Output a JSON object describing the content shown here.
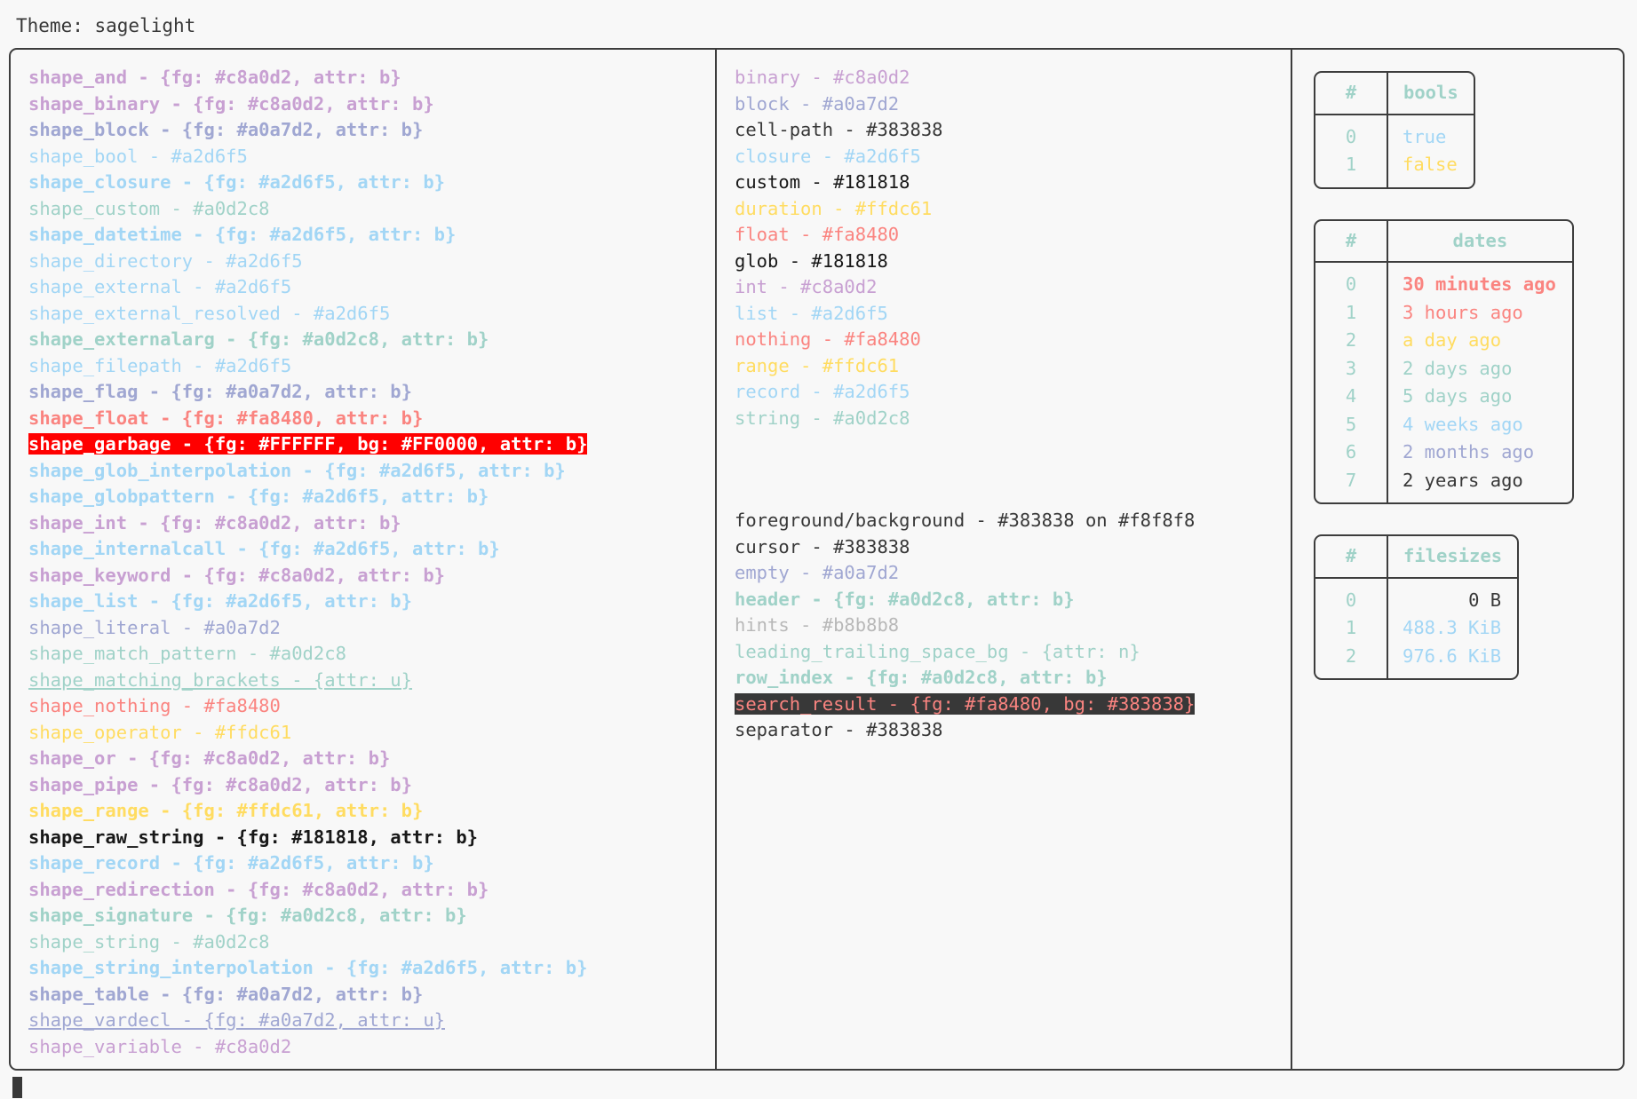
{
  "header": {
    "label": "Theme: sagelight"
  },
  "palette": {
    "fg": "#383838",
    "bg": "#f8f8f8",
    "purple": "#c8a0d2",
    "lavender": "#a0a7d2",
    "blue": "#a2d6f5",
    "green": "#a0d2c8",
    "red": "#fa8480",
    "yellow": "#ffdc61",
    "black": "#181818",
    "grey": "#b8b8b8",
    "dark": "#383838",
    "garbage_bg": "#FF0000",
    "garbage_fg": "#FFFFFF"
  },
  "shapes": [
    {
      "text": "shape_and - {fg: #c8a0d2, attr: b}",
      "color": "#c8a0d2",
      "bold": true,
      "underline": false
    },
    {
      "text": "shape_binary - {fg: #c8a0d2, attr: b}",
      "color": "#c8a0d2",
      "bold": true,
      "underline": false
    },
    {
      "text": "shape_block - {fg: #a0a7d2, attr: b}",
      "color": "#a0a7d2",
      "bold": true,
      "underline": false
    },
    {
      "text": "shape_bool - #a2d6f5",
      "color": "#a2d6f5",
      "bold": false,
      "underline": false
    },
    {
      "text": "shape_closure - {fg: #a2d6f5, attr: b}",
      "color": "#a2d6f5",
      "bold": true,
      "underline": false
    },
    {
      "text": "shape_custom - #a0d2c8",
      "color": "#a0d2c8",
      "bold": false,
      "underline": false
    },
    {
      "text": "shape_datetime - {fg: #a2d6f5, attr: b}",
      "color": "#a2d6f5",
      "bold": true,
      "underline": false
    },
    {
      "text": "shape_directory - #a2d6f5",
      "color": "#a2d6f5",
      "bold": false,
      "underline": false
    },
    {
      "text": "shape_external - #a2d6f5",
      "color": "#a2d6f5",
      "bold": false,
      "underline": false
    },
    {
      "text": "shape_external_resolved - #a2d6f5",
      "color": "#a2d6f5",
      "bold": false,
      "underline": false
    },
    {
      "text": "shape_externalarg - {fg: #a0d2c8, attr: b}",
      "color": "#a0d2c8",
      "bold": true,
      "underline": false
    },
    {
      "text": "shape_filepath - #a2d6f5",
      "color": "#a2d6f5",
      "bold": false,
      "underline": false
    },
    {
      "text": "shape_flag - {fg: #a0a7d2, attr: b}",
      "color": "#a0a7d2",
      "bold": true,
      "underline": false
    },
    {
      "text": "shape_float - {fg: #fa8480, attr: b}",
      "color": "#fa8480",
      "bold": true,
      "underline": false
    },
    {
      "text": "shape_garbage - {fg: #FFFFFF, bg: #FF0000, attr: b}",
      "color": "#FFFFFF",
      "bg": "#FF0000",
      "bold": true,
      "underline": false
    },
    {
      "text": "shape_glob_interpolation - {fg: #a2d6f5, attr: b}",
      "color": "#a2d6f5",
      "bold": true,
      "underline": false
    },
    {
      "text": "shape_globpattern - {fg: #a2d6f5, attr: b}",
      "color": "#a2d6f5",
      "bold": true,
      "underline": false
    },
    {
      "text": "shape_int - {fg: #c8a0d2, attr: b}",
      "color": "#c8a0d2",
      "bold": true,
      "underline": false
    },
    {
      "text": "shape_internalcall - {fg: #a2d6f5, attr: b}",
      "color": "#a2d6f5",
      "bold": true,
      "underline": false
    },
    {
      "text": "shape_keyword - {fg: #c8a0d2, attr: b}",
      "color": "#c8a0d2",
      "bold": true,
      "underline": false
    },
    {
      "text": "shape_list - {fg: #a2d6f5, attr: b}",
      "color": "#a2d6f5",
      "bold": true,
      "underline": false
    },
    {
      "text": "shape_literal - #a0a7d2",
      "color": "#a0a7d2",
      "bold": false,
      "underline": false
    },
    {
      "text": "shape_match_pattern - #a0d2c8",
      "color": "#a0d2c8",
      "bold": false,
      "underline": false
    },
    {
      "text": "shape_matching_brackets - {attr: u}",
      "color": "#a0d2c8",
      "bold": false,
      "underline": true
    },
    {
      "text": "shape_nothing - #fa8480",
      "color": "#fa8480",
      "bold": false,
      "underline": false
    },
    {
      "text": "shape_operator - #ffdc61",
      "color": "#ffdc61",
      "bold": false,
      "underline": false
    },
    {
      "text": "shape_or - {fg: #c8a0d2, attr: b}",
      "color": "#c8a0d2",
      "bold": true,
      "underline": false
    },
    {
      "text": "shape_pipe - {fg: #c8a0d2, attr: b}",
      "color": "#c8a0d2",
      "bold": true,
      "underline": false
    },
    {
      "text": "shape_range - {fg: #ffdc61, attr: b}",
      "color": "#ffdc61",
      "bold": true,
      "underline": false
    },
    {
      "text": "shape_raw_string - {fg: #181818, attr: b}",
      "color": "#181818",
      "bold": true,
      "underline": false
    },
    {
      "text": "shape_record - {fg: #a2d6f5, attr: b}",
      "color": "#a2d6f5",
      "bold": true,
      "underline": false
    },
    {
      "text": "shape_redirection - {fg: #c8a0d2, attr: b}",
      "color": "#c8a0d2",
      "bold": true,
      "underline": false
    },
    {
      "text": "shape_signature - {fg: #a0d2c8, attr: b}",
      "color": "#a0d2c8",
      "bold": true,
      "underline": false
    },
    {
      "text": "shape_string - #a0d2c8",
      "color": "#a0d2c8",
      "bold": false,
      "underline": false
    },
    {
      "text": "shape_string_interpolation - {fg: #a2d6f5, attr: b}",
      "color": "#a2d6f5",
      "bold": true,
      "underline": false
    },
    {
      "text": "shape_table - {fg: #a0a7d2, attr: b}",
      "color": "#a0a7d2",
      "bold": true,
      "underline": false
    },
    {
      "text": "shape_vardecl - {fg: #a0a7d2, attr: u}",
      "color": "#a0a7d2",
      "bold": false,
      "underline": true
    },
    {
      "text": "shape_variable - #c8a0d2",
      "color": "#c8a0d2",
      "bold": false,
      "underline": false
    }
  ],
  "types": [
    {
      "text": "binary - #c8a0d2",
      "color": "#c8a0d2",
      "bold": false,
      "underline": false
    },
    {
      "text": "block - #a0a7d2",
      "color": "#a0a7d2",
      "bold": false,
      "underline": false
    },
    {
      "text": "cell-path - #383838",
      "color": "#383838",
      "bold": false,
      "underline": false
    },
    {
      "text": "closure - #a2d6f5",
      "color": "#a2d6f5",
      "bold": false,
      "underline": false
    },
    {
      "text": "custom - #181818",
      "color": "#181818",
      "bold": false,
      "underline": false
    },
    {
      "text": "duration - #ffdc61",
      "color": "#ffdc61",
      "bold": false,
      "underline": false
    },
    {
      "text": "float - #fa8480",
      "color": "#fa8480",
      "bold": false,
      "underline": false
    },
    {
      "text": "glob - #181818",
      "color": "#181818",
      "bold": false,
      "underline": false
    },
    {
      "text": "int - #c8a0d2",
      "color": "#c8a0d2",
      "bold": false,
      "underline": false
    },
    {
      "text": "list - #a2d6f5",
      "color": "#a2d6f5",
      "bold": false,
      "underline": false
    },
    {
      "text": "nothing - #fa8480",
      "color": "#fa8480",
      "bold": false,
      "underline": false
    },
    {
      "text": "range - #ffdc61",
      "color": "#ffdc61",
      "bold": false,
      "underline": false
    },
    {
      "text": "record - #a2d6f5",
      "color": "#a2d6f5",
      "bold": false,
      "underline": false
    },
    {
      "text": "string - #a0d2c8",
      "color": "#a0d2c8",
      "bold": false,
      "underline": false
    }
  ],
  "ui_elements": [
    {
      "text": "foreground/background - #383838 on #f8f8f8",
      "color": "#383838",
      "bold": false,
      "underline": false
    },
    {
      "text": "cursor - #383838",
      "color": "#383838",
      "bold": false,
      "underline": false
    },
    {
      "text": "empty - #a0a7d2",
      "color": "#a0a7d2",
      "bold": false,
      "underline": false
    },
    {
      "text": "header - {fg: #a0d2c8, attr: b}",
      "color": "#a0d2c8",
      "bold": true,
      "underline": false
    },
    {
      "text": "hints - #b8b8b8",
      "color": "#b8b8b8",
      "bold": false,
      "underline": false
    },
    {
      "text": "leading_trailing_space_bg - {attr: n}",
      "color": "#a0d2c8",
      "bold": false,
      "underline": false
    },
    {
      "text": "row_index - {fg: #a0d2c8, attr: b}",
      "color": "#a0d2c8",
      "bold": true,
      "underline": false
    },
    {
      "text": "search_result - {fg: #fa8480, bg: #383838}",
      "color": "#fa8480",
      "bg": "#383838",
      "bold": false,
      "underline": false
    },
    {
      "text": "separator - #383838",
      "color": "#383838",
      "bold": false,
      "underline": false
    }
  ],
  "tables": [
    {
      "name": "bools",
      "index_header": "#",
      "value_header": "bools",
      "align": "left",
      "rows": [
        {
          "index": "0",
          "value": "true",
          "color": "#a2d6f5",
          "bold": false
        },
        {
          "index": "1",
          "value": "false",
          "color": "#ffdc61",
          "bold": false
        }
      ]
    },
    {
      "name": "dates",
      "index_header": "#",
      "value_header": "dates",
      "align": "left",
      "rows": [
        {
          "index": "0",
          "value": "30 minutes ago",
          "color": "#fa8480",
          "bold": true
        },
        {
          "index": "1",
          "value": "3 hours ago",
          "color": "#fa8480",
          "bold": false
        },
        {
          "index": "2",
          "value": "a day ago",
          "color": "#ffdc61",
          "bold": false
        },
        {
          "index": "3",
          "value": "2 days ago",
          "color": "#a0d2c8",
          "bold": false
        },
        {
          "index": "4",
          "value": "5 days ago",
          "color": "#a0d2c8",
          "bold": false
        },
        {
          "index": "5",
          "value": "4 weeks ago",
          "color": "#a2d6f5",
          "bold": false
        },
        {
          "index": "6",
          "value": "2 months ago",
          "color": "#a0a7d2",
          "bold": false
        },
        {
          "index": "7",
          "value": "2 years ago",
          "color": "#383838",
          "bold": false
        }
      ]
    },
    {
      "name": "filesizes",
      "index_header": "#",
      "value_header": "filesizes",
      "align": "right",
      "rows": [
        {
          "index": "0",
          "value": "0 B",
          "color": "#383838",
          "bold": false
        },
        {
          "index": "1",
          "value": "488.3 KiB",
          "color": "#a2d6f5",
          "bold": false
        },
        {
          "index": "2",
          "value": "976.6 KiB",
          "color": "#a2d6f5",
          "bold": false
        }
      ]
    }
  ],
  "prompt": {
    "cursor": "block-cursor"
  }
}
